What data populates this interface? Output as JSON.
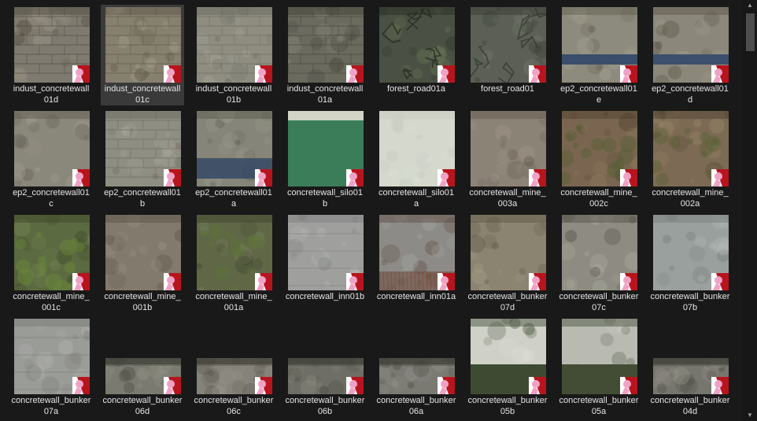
{
  "items": [
    {
      "label": "indust_concretewall01d",
      "base": "#7f7a6f",
      "dark": "#4a4437",
      "light": "#a39d8f",
      "pattern": "brick",
      "selected": false
    },
    {
      "label": "indust_concretewall01c",
      "base": "#86806f",
      "dark": "#5a5242",
      "light": "#aaa392",
      "pattern": "brick",
      "selected": true
    },
    {
      "label": "indust_concretewall01b",
      "base": "#8e8d80",
      "dark": "#66665a",
      "light": "#b0afa3",
      "pattern": "brick",
      "selected": false
    },
    {
      "label": "indust_concretewall01a",
      "base": "#6b6a5f",
      "dark": "#3e3d34",
      "light": "#8e8c80",
      "pattern": "brick",
      "selected": false
    },
    {
      "label": "forest_road01a",
      "base": "#4a5043",
      "dark": "#252a21",
      "light": "#6d7a5a",
      "pattern": "cracks",
      "selected": false
    },
    {
      "label": "forest_road01",
      "base": "#5b5f55",
      "dark": "#353a32",
      "light": "#7a7f71",
      "pattern": "cracks",
      "selected": false
    },
    {
      "label": "ep2_concretewall01e",
      "base": "#8d8b7d",
      "dark": "#5e5a4c",
      "light": "#a9a797",
      "pattern": "band",
      "band": "#3a4e6b",
      "selected": false
    },
    {
      "label": "ep2_concretewall01d",
      "base": "#8b877a",
      "dark": "#5a5547",
      "light": "#a8a495",
      "pattern": "band",
      "band": "#3c506e",
      "selected": false
    },
    {
      "label": "ep2_concretewall01c",
      "base": "#8a877b",
      "dark": "#5e5a4e",
      "light": "#a7a496",
      "pattern": "plain",
      "selected": false
    },
    {
      "label": "ep2_concretewall01b",
      "base": "#8f8e83",
      "dark": "#66655a",
      "light": "#adac9f",
      "pattern": "brick",
      "selected": false
    },
    {
      "label": "ep2_concretewall01a",
      "base": "#858579",
      "dark": "#56564a",
      "light": "#a3a396",
      "pattern": "bandlow",
      "band": "#3a4c66",
      "selected": false
    },
    {
      "label": "concretewall_silo01b",
      "base": "#3a7d58",
      "dark": "#2e6a49",
      "light": "#d2d4c6",
      "pattern": "silo",
      "selected": false
    },
    {
      "label": "concretewall_silo01a",
      "base": "#d4d8cd",
      "dark": "#c6cabe",
      "light": "#e0e3d9",
      "pattern": "plain",
      "selected": false
    },
    {
      "label": "concretewall_mine_003a",
      "base": "#8c8377",
      "dark": "#5f554a",
      "light": "#aaa295",
      "pattern": "plain",
      "selected": false
    },
    {
      "label": "concretewall_mine_002c",
      "base": "#7a6650",
      "dark": "#4b3e2d",
      "light": "#9a8668",
      "pattern": "moss",
      "moss": "#556032",
      "selected": false
    },
    {
      "label": "concretewall_mine_002a",
      "base": "#7c6a54",
      "dark": "#4d4030",
      "light": "#9c896b",
      "pattern": "moss",
      "moss": "#5a6235",
      "selected": false
    },
    {
      "label": "concretewall_mine_001c",
      "base": "#5b6a40",
      "dark": "#3b4528",
      "light": "#7d8a58",
      "pattern": "moss",
      "moss": "#6a8a3a",
      "selected": false
    },
    {
      "label": "concretewall_mine_001b",
      "base": "#827a6c",
      "dark": "#574f42",
      "light": "#a09888",
      "pattern": "plain",
      "selected": false
    },
    {
      "label": "concretewall_mine_001a",
      "base": "#5f6747",
      "dark": "#3c422b",
      "light": "#7f8760",
      "pattern": "moss",
      "moss": "#5e7335",
      "selected": false
    },
    {
      "label": "concretewall_inn01b",
      "base": "#9fa09e",
      "dark": "#7a7b79",
      "light": "#b9bab8",
      "pattern": "lines",
      "selected": false
    },
    {
      "label": "concretewall_inn01a",
      "base": "#8c8b88",
      "dark": "#5e4a40",
      "light": "#a8a7a3",
      "pattern": "rust",
      "selected": false
    },
    {
      "label": "concretewall_bunker07d",
      "base": "#8a8470",
      "dark": "#5c5645",
      "light": "#a8a28b",
      "pattern": "plain",
      "selected": false
    },
    {
      "label": "concretewall_bunker07c",
      "base": "#8e8c82",
      "dark": "#4d4a42",
      "light": "#b0aea3",
      "pattern": "plain",
      "selected": false
    },
    {
      "label": "concretewall_bunker07b",
      "base": "#9aa09e",
      "dark": "#747a78",
      "light": "#b6bbb9",
      "pattern": "plain",
      "selected": false
    },
    {
      "label": "concretewall_bunker07a",
      "base": "#9a9c98",
      "dark": "#767874",
      "light": "#b6b8b3",
      "pattern": "lines",
      "selected": false
    },
    {
      "label": "concretewall_bunker06d",
      "base": "#7a7a70",
      "dark": "#4a4a42",
      "light": "#9a9a90",
      "pattern": "strip",
      "selected": false
    },
    {
      "label": "concretewall_bunker06c",
      "base": "#86837a",
      "dark": "#56534a",
      "light": "#a4a196",
      "pattern": "strip",
      "selected": false
    },
    {
      "label": "concretewall_bunker06b",
      "base": "#6e6e66",
      "dark": "#44443c",
      "light": "#8e8e84",
      "pattern": "strip",
      "selected": false
    },
    {
      "label": "concretewall_bunker06a",
      "base": "#7a7972",
      "dark": "#4a4944",
      "light": "#989790",
      "pattern": "strip",
      "selected": false
    },
    {
      "label": "concretewall_bunker05b",
      "base": "#cfd1c8",
      "dark": "#3f4a33",
      "light": "#e0e1da",
      "pattern": "twotone",
      "selected": false
    },
    {
      "label": "concretewall_bunker05a",
      "base": "#b9bbb2",
      "dark": "#434d36",
      "light": "#cfd0c9",
      "pattern": "twotone",
      "selected": false
    },
    {
      "label": "concretewall_bunker04d",
      "base": "#77766e",
      "dark": "#46453f",
      "light": "#96958c",
      "pattern": "strip",
      "selected": false
    }
  ],
  "badge": {
    "icon": "vtf-badge-icon",
    "red": "#b8141e",
    "pink": "#f0a2c4",
    "white": "#ffffff"
  },
  "scrollbar": {
    "up": "▲",
    "down": "▼"
  }
}
